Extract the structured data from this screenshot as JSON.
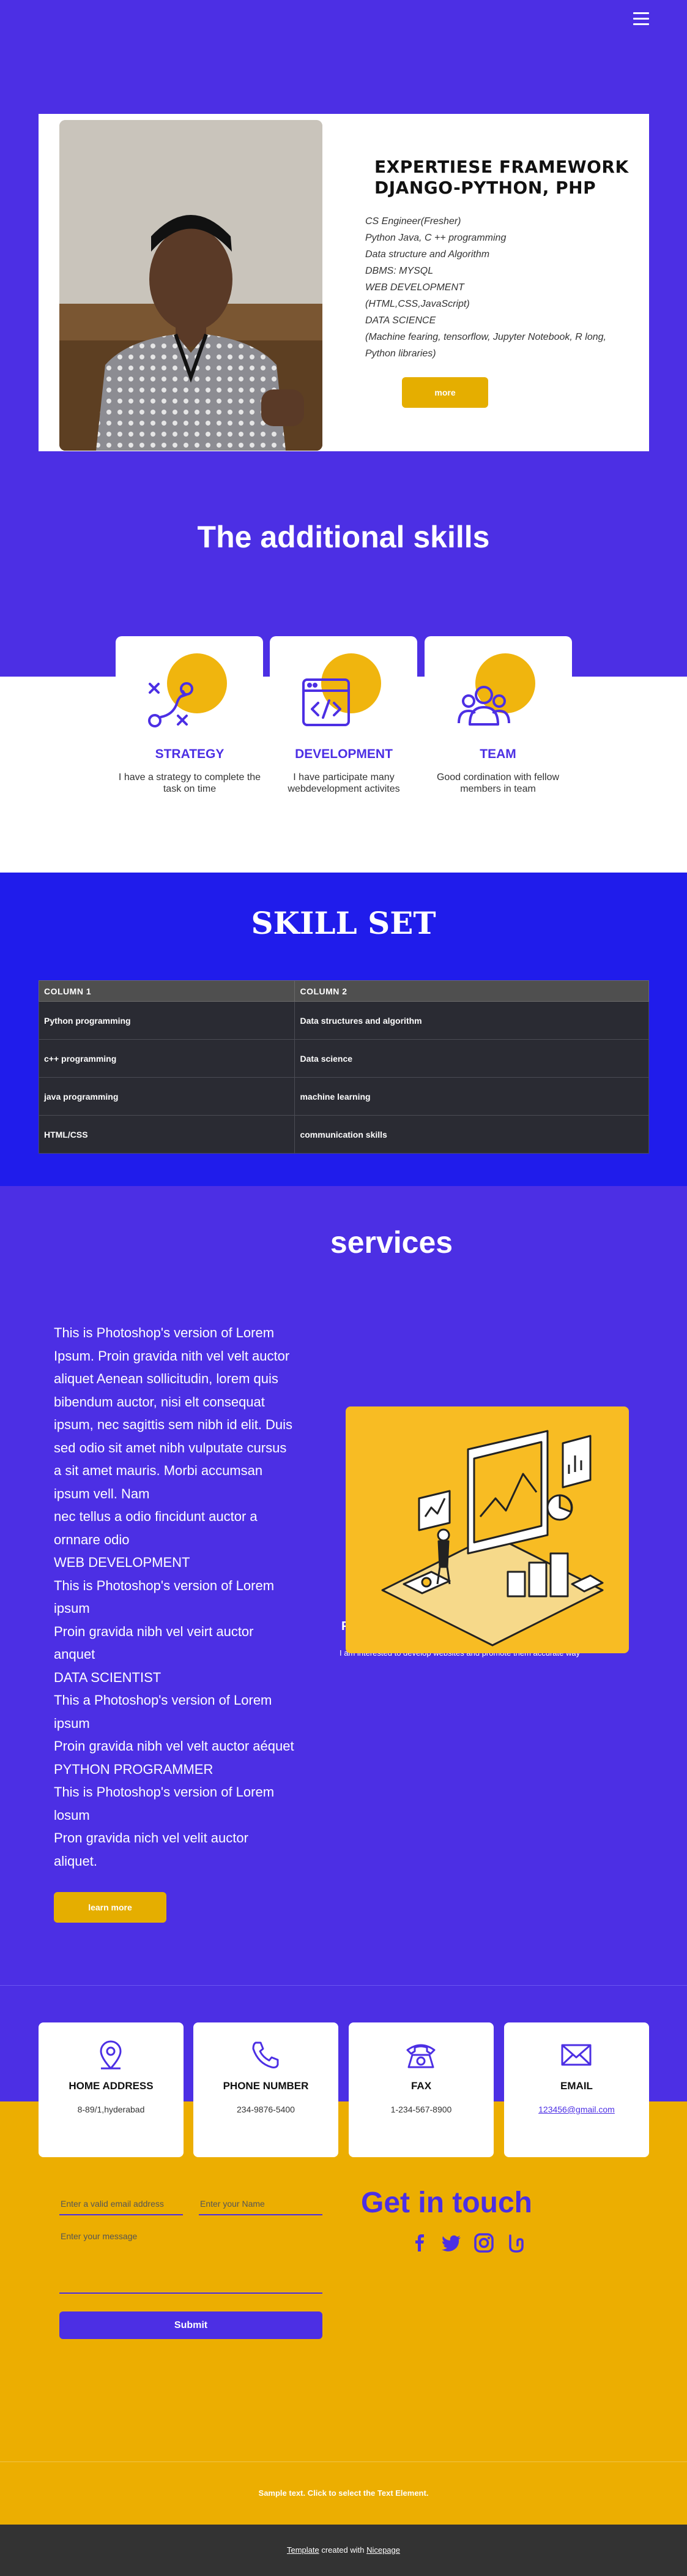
{
  "header": {
    "menu_icon": "hamburger-menu-icon"
  },
  "hero": {
    "title": "EXPERTIESE  FRAMEWORK DJANGO-PYTHON, PHP",
    "lines": [
      "CS Engineer(Fresher)",
      "Python Java, C ++ programming",
      "Data structure and Algorithm",
      "DBMS: MYSQL",
      "WEB DEVELOPMENT",
      "(HTML,CSS,JavaScript)",
      "DATA SCIENCE",
      "(Machine fearing, tensorflow, Jupyter Notebook, R long,",
      "Python libraries)"
    ],
    "more_label": "more"
  },
  "additional": {
    "title": "The additional skills",
    "cards": [
      {
        "heading": "STRATEGY",
        "desc": "I have a strategy to complete the task on time",
        "icon": "strategy-icon"
      },
      {
        "heading": "DEVELOPMENT",
        "desc": "I have participate many webdevelopment activites",
        "icon": "code-window-icon"
      },
      {
        "heading": "TEAM",
        "desc": "Good cordination with fellow members in team",
        "icon": "team-icon"
      }
    ]
  },
  "skillset": {
    "title": "SKILL SET",
    "columns": [
      "COLUMN 1",
      "COLUMN 2"
    ],
    "rows": [
      [
        "Python programming",
        "Data structures and algorithm"
      ],
      [
        "c++ programming",
        "Data science"
      ],
      [
        "java programming",
        "machine learning"
      ],
      [
        "HTML/CSS",
        "communication skills"
      ]
    ]
  },
  "services": {
    "title": "services",
    "lines": [
      "This is Photoshop's version of Lorem",
      "Ipsum. Proin gravida nith vel velt auctor",
      "aliquet Aenean sollicitudin, lorem quis",
      "bibendum auctor, nisi elt consequat",
      "ipsum, nec sagittis sem nibh id elit. Duis",
      "sed odio sit amet nibh vulputate cursus",
      "a sit amet mauris. Morbi accumsan",
      "ipsum vell. Nam",
      "nec tellus a odio fincidunt auctor a",
      "ornnare odio",
      "WEB DEVELOPMENT",
      "This is Photoshop's version of Lorem",
      "ipsum",
      "Proin gravida nibh vel veirt auctor",
      "anquet",
      "DATA SCIENTIST",
      "This a Photoshop's version of Lorem",
      "ipsum",
      "Proin gravida nibh vel velt auctor aéquet",
      "PYTHON PROGRAMMER",
      "This is Photoshop's version of Lorem",
      "losum",
      "Pron gravida nich vel velit auctor",
      "aliquet."
    ],
    "learn_more_label": "learn more",
    "hidden_heading": "P",
    "hidden_text": "I am interested to develop websites and promote them accurate way"
  },
  "contact_cards": [
    {
      "title": "HOME ADDRESS",
      "value": "8-89/1,hyderabad",
      "icon": "location-pin-icon"
    },
    {
      "title": "PHONE NUMBER",
      "value": "234-9876-5400",
      "icon": "phone-icon"
    },
    {
      "title": "FAX",
      "value": "1-234-567-8900",
      "icon": "fax-icon"
    },
    {
      "title": "EMAIL",
      "value": "123456@gmail.com",
      "icon": "envelope-icon"
    }
  ],
  "form": {
    "email_placeholder": "Enter a valid email address",
    "name_placeholder": "Enter your Name",
    "message_placeholder": "Enter your message",
    "submit_label": "Submit"
  },
  "get_in_touch": {
    "title": "Get in touch",
    "social": [
      "facebook-icon",
      "twitter-icon",
      "instagram-icon",
      "threads-icon"
    ]
  },
  "footer": {
    "sample_text": "Sample text. Click to select the Text Element.",
    "credit_link": "Template",
    "credit_middle": " created with ",
    "credit_brand": "Nicepage"
  },
  "colors": {
    "primary": "#4c2fe4",
    "accent": "#ecae01",
    "skillset_bg": "#201ceb",
    "dark": "#333333"
  }
}
